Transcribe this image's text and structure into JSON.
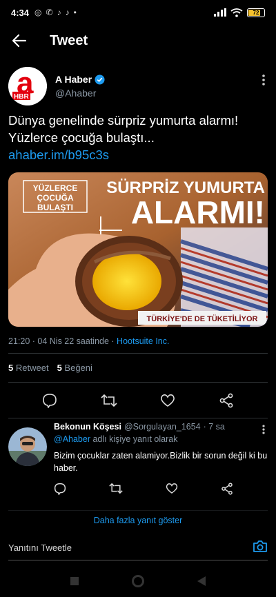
{
  "status_bar": {
    "time": "4:34",
    "battery": "72",
    "notif_icons": [
      "bullseye-icon",
      "whatsapp-icon",
      "tiktok-icon",
      "tiktok-icon",
      "dot-icon"
    ]
  },
  "header": {
    "title": "Tweet"
  },
  "tweet": {
    "author_name": "A Haber",
    "author_handle": "@Ahaber",
    "logo_letter": "a",
    "logo_sub": "HBR",
    "text_line1": "Dünya genelinde sürpriz yumurta alarmı!",
    "text_line2": "Yüzlerce çocuğa bulaştı...",
    "link": "ahaber.im/b95c3s",
    "media": {
      "badge_line1": "YÜZLERCE",
      "badge_line2": "ÇOCUĞA",
      "badge_line3": "BULAŞTI",
      "headline1": "SÜRPRİZ YUMURTA",
      "headline2": "ALARMI!",
      "footer": "TÜRKİYE'DE DE TÜKETİLİYOR"
    },
    "timestamp": "21:20 · 04 Nis 22 saatinde · ",
    "source_app": "Hootsuite Inc.",
    "retweets_count": "5",
    "retweets_label": "Retweet",
    "likes_count": "5",
    "likes_label": "Beğeni"
  },
  "reply": {
    "name": "Bekonun Köşesi",
    "handle": "@Sorgulayan_1654",
    "time": "· 7 sa",
    "reply_to_mention": "@Ahaber",
    "reply_to_text": "adlı kişiye yanıt olarak",
    "text": "Bizim çocuklar zaten alamiyor.Bizlik bir sorun değil ki bu haber."
  },
  "more_replies": "Daha fazla yanıt göster",
  "composer": {
    "placeholder": "Yanıtını Tweetle"
  },
  "colors": {
    "accent": "#1d9bf0",
    "background": "#000000",
    "logo_red": "#e3000f"
  }
}
